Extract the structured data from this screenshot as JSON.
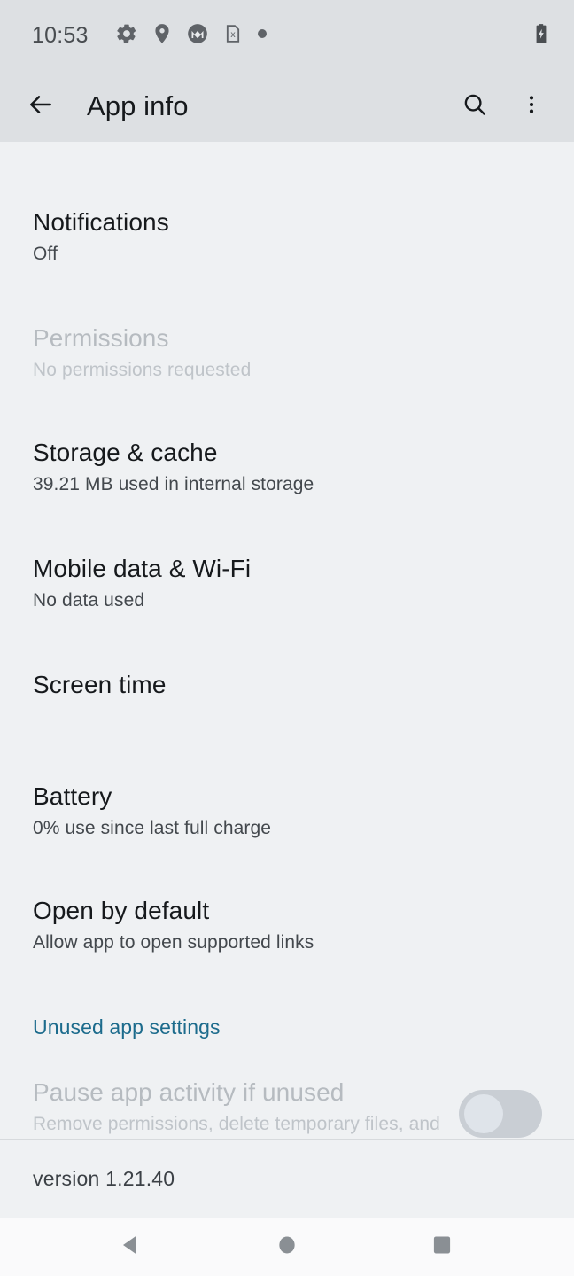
{
  "status_bar": {
    "time": "10:53",
    "icons": [
      "settings-gear-icon",
      "location-pin-icon",
      "motorola-logo-icon",
      "no-sim-card-icon",
      "dot-indicator-icon"
    ],
    "battery": "battery-charging-icon"
  },
  "app_bar": {
    "back_icon": "back-arrow-icon",
    "title": "App info",
    "search_icon": "search-icon",
    "overflow_icon": "more-options-icon"
  },
  "rows": [
    {
      "name": "notifications",
      "title": "Notifications",
      "subtitle": "Off",
      "disabled": false
    },
    {
      "name": "permissions",
      "title": "Permissions",
      "subtitle": "No permissions requested",
      "disabled": true
    },
    {
      "name": "storage-and-cache",
      "title": "Storage & cache",
      "subtitle": "39.21 MB used in internal storage",
      "disabled": false
    },
    {
      "name": "mobile-data-and-wifi",
      "title": "Mobile data & Wi-Fi",
      "subtitle": "No data used",
      "disabled": false
    },
    {
      "name": "screen-time",
      "title": "Screen time",
      "subtitle": "",
      "disabled": false
    },
    {
      "name": "battery",
      "title": "Battery",
      "subtitle": "0% use since last full charge",
      "disabled": false
    },
    {
      "name": "open-by-default",
      "title": "Open by default",
      "subtitle": "Allow app to open supported links",
      "disabled": false
    }
  ],
  "unused_section": {
    "header": "Unused app settings",
    "toggle_row": {
      "title": "Pause app activity if unused",
      "subtitle": "Remove permissions, delete temporary files, and stop notifications",
      "toggle_state": "off",
      "disabled": true
    }
  },
  "footer": {
    "version": "version 1.21.40"
  },
  "nav_bar": {
    "back": "back-triangle-icon",
    "home": "home-circle-icon",
    "recents": "recents-square-icon"
  },
  "colors": {
    "app_bar_bg": "#dde0e3",
    "content_bg": "#eff1f3",
    "nav_bar_bg": "#fafafb",
    "link_blue": "#1c6b8c",
    "primary_text": "#16191c",
    "secondary_text": "#43484d",
    "disabled_text": "#b6bbc0",
    "toggle_track": "#c9ced4",
    "toggle_thumb": "#dfe4ea"
  }
}
